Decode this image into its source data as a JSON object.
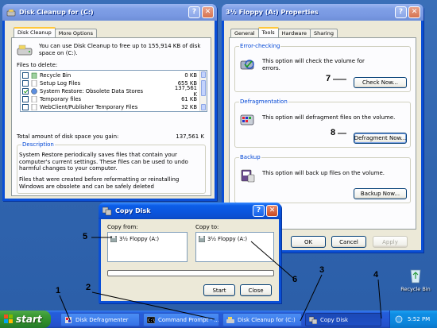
{
  "colors": {
    "desktop": "#3a6ea5",
    "titlebar_active": "#0a55de",
    "titlebar_inactive": "#7898e2",
    "accent_label": "#0046d5"
  },
  "disk_cleanup": {
    "title": "Disk Cleanup for  (C:)",
    "tabs": [
      "Disk Cleanup",
      "More Options"
    ],
    "intro": "You can use Disk Cleanup to free up to 155,914 KB of disk space on  (C:).",
    "files_label": "Files to delete:",
    "files": [
      {
        "name": "Recycle Bin",
        "size": "0 KB",
        "checked": false
      },
      {
        "name": "Setup Log Files",
        "size": "655 KB",
        "checked": false
      },
      {
        "name": "System Restore: Obsolete Data Stores",
        "size": "137,561 K",
        "checked": true
      },
      {
        "name": "Temporary files",
        "size": "61 KB",
        "checked": false
      },
      {
        "name": "WebClient/Publisher Temporary Files",
        "size": "32 KB",
        "checked": false
      }
    ],
    "total_label": "Total amount of disk space you gain:",
    "total_value": "137,561 K",
    "description_label": "Description",
    "description_1": "System Restore periodically saves files that contain your computer's current settings.  These files can be used to undo harmful changes to your computer.",
    "description_2": "Files that were created before reformatting or reinstalling Windows are obsolete and can be safely deleted"
  },
  "properties": {
    "title": "3½ Floppy (A:) Properties",
    "tabs": [
      "General",
      "Tools",
      "Hardware",
      "Sharing"
    ],
    "error_checking": {
      "label": "Error-checking",
      "text": "This option will check the volume for errors.",
      "button": "Check Now..."
    },
    "defrag": {
      "label": "Defragmentation",
      "text": "This option will defragment files on the volume.",
      "button": "Defragment Now..."
    },
    "backup": {
      "label": "Backup",
      "text": "This option will back up files on the volume.",
      "button": "Backup Now..."
    },
    "ok": "OK",
    "cancel": "Cancel",
    "apply": "Apply"
  },
  "copy_disk": {
    "title": "Copy Disk",
    "from_label": "Copy from:",
    "to_label": "Copy to:",
    "from_item": "3½ Floppy (A:)",
    "to_item": "3½ Floppy (A:)",
    "start": "Start",
    "close": "Close"
  },
  "taskbar": {
    "start": "start",
    "tasks": [
      "Disk Defragmenter",
      "Command Prompt - ...",
      "Disk Cleanup for  (C:)",
      "Copy Disk"
    ],
    "clock": "5:52 PM"
  },
  "desktop": {
    "recycle_bin": "Recycle Bin"
  },
  "callouts": [
    "1",
    "2",
    "3",
    "4",
    "5",
    "6",
    "7",
    "8"
  ]
}
